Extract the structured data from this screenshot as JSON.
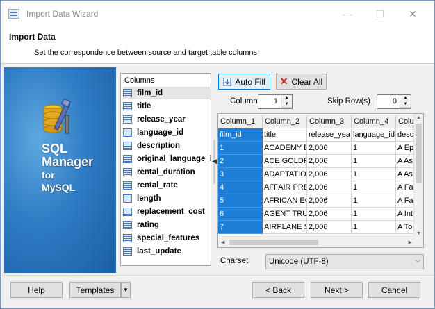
{
  "window": {
    "title": "Import Data Wizard",
    "minimize": "—",
    "maximize": "☐",
    "close": "✕"
  },
  "header": {
    "title": "Import Data",
    "subtitle": "Set the correspondence between source and target table columns"
  },
  "banner": {
    "line1": "SQL",
    "line2": "Manager",
    "line3": "for",
    "line4": "MySQL"
  },
  "columns": {
    "header": "Columns",
    "items": [
      "film_id",
      "title",
      "release_year",
      "language_id",
      "description",
      "original_language_i",
      "rental_duration",
      "rental_rate",
      "length",
      "replacement_cost",
      "rating",
      "special_features",
      "last_update"
    ],
    "selected_index": 0
  },
  "toolbar": {
    "auto_fill": "Auto Fill",
    "clear_all": "Clear All"
  },
  "column_spin": {
    "label": "Column",
    "value": "1"
  },
  "skip_rows": {
    "label": "Skip Row(s)",
    "value": "0"
  },
  "grid": {
    "headers": [
      "Column_1",
      "Column_2",
      "Column_3",
      "Column_4",
      "Colu"
    ],
    "rows": [
      [
        "film_id",
        "title",
        "release_yea",
        "language_id",
        "desc"
      ],
      [
        "1",
        "ACADEMY D",
        "2,006",
        "1",
        "A Ep"
      ],
      [
        "2",
        "ACE GOLDF",
        "2,006",
        "1",
        "A As"
      ],
      [
        "3",
        "ADAPTATIO",
        "2,006",
        "1",
        "A As"
      ],
      [
        "4",
        "AFFAIR PRE",
        "2,006",
        "1",
        "A Fa"
      ],
      [
        "5",
        "AFRICAN EG",
        "2,006",
        "1",
        "A Fa"
      ],
      [
        "6",
        "AGENT TRU",
        "2,006",
        "1",
        "A Int"
      ],
      [
        "7",
        "AIRPLANE S",
        "2,006",
        "1",
        "A To"
      ]
    ]
  },
  "charset": {
    "label": "Charset",
    "value": "Unicode (UTF-8)"
  },
  "footer": {
    "help": "Help",
    "templates": "Templates",
    "back": "< Back",
    "next": "Next >",
    "cancel": "Cancel"
  },
  "colors": {
    "accent": "#0078d7",
    "highlight": "#1c7ed6"
  }
}
